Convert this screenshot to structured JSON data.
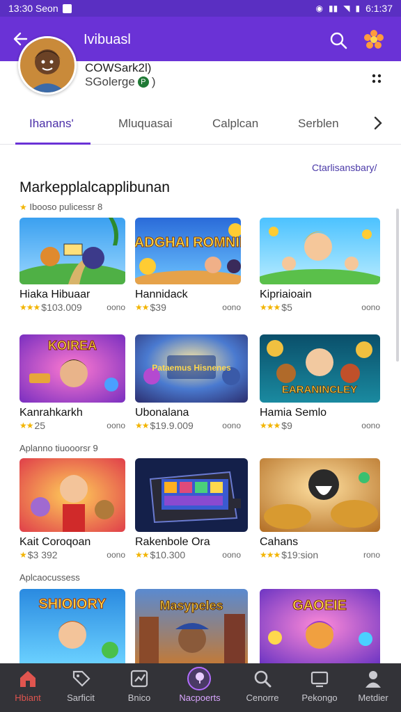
{
  "status_bar": {
    "left_text": "13:30 Seon",
    "right_text": "6:1:37"
  },
  "app_bar": {
    "title": "Ivibuasl"
  },
  "profile": {
    "name": "COWSark2l)",
    "sub_label": "SGolerge",
    "coin_badge": "P",
    "coin_suffix": ")"
  },
  "tabs": [
    {
      "label": "Ihanans'",
      "active": true
    },
    {
      "label": "Mluquasai",
      "active": false
    },
    {
      "label": "Calplcan",
      "active": false
    },
    {
      "label": "Serblen",
      "active": false
    }
  ],
  "content": {
    "see_all": "Ctarlisansbary/",
    "section_title": "Markepplalcapplibunan",
    "section_sub_1": "Ibooso pulicessr 8",
    "section_sub_2": "Aplanno tiuooorsr 9",
    "section_sub_3": "Aplcaocussess"
  },
  "cards": [
    {
      "name": "Hiaka Hibuaar",
      "price": "$103.009",
      "tag": "oono",
      "stars": "★★★"
    },
    {
      "name": "Hannidack",
      "price": "$39",
      "tag": "oono",
      "stars": "★★"
    },
    {
      "name": "Kipriaioain",
      "price": "$5",
      "tag": "oono",
      "stars": "★★★"
    },
    {
      "name": "Kanrahkarkh",
      "price": "25",
      "tag": "oono",
      "stars": "★★"
    },
    {
      "name": "Ubonalana",
      "price": "$19.9.009",
      "tag": "oono",
      "stars": "★★"
    },
    {
      "name": "Hamia Semlo",
      "price": "$9",
      "tag": "oono",
      "stars": "★★★"
    },
    {
      "name": "Kait Coroqoan",
      "price": "$3 392",
      "tag": "oono",
      "stars": "★"
    },
    {
      "name": "Rakenbole Ora",
      "price": "$10.300",
      "tag": "oono",
      "stars": "★★"
    },
    {
      "name": "Cahans",
      "price": "$19:sion",
      "tag": "rono",
      "stars": "★★★"
    }
  ],
  "thumb_titles": [
    "",
    "SADGHAI ROMNIES",
    "",
    "KOIREA",
    "Pataemus Hisnenes",
    "EARANINCLEY",
    "",
    "",
    "",
    "SHIOIORY",
    "Masypeles",
    "GAOEIE"
  ],
  "bottom_nav": [
    {
      "label": "Hbiant",
      "icon": "home-icon"
    },
    {
      "label": "Sarficit",
      "icon": "tag-icon"
    },
    {
      "label": "Bnico",
      "icon": "chart-icon"
    },
    {
      "label": "Nacpoerts",
      "icon": "pin-icon"
    },
    {
      "label": "Cenorre",
      "icon": "search-icon"
    },
    {
      "label": "Pekongo",
      "icon": "screen-icon"
    },
    {
      "label": "Metdier",
      "icon": "person-icon"
    }
  ],
  "colors": {
    "accent": "#6a32d6",
    "status_bar": "#5a2fc2",
    "nav_bg": "#333338",
    "star": "#f2b400"
  }
}
